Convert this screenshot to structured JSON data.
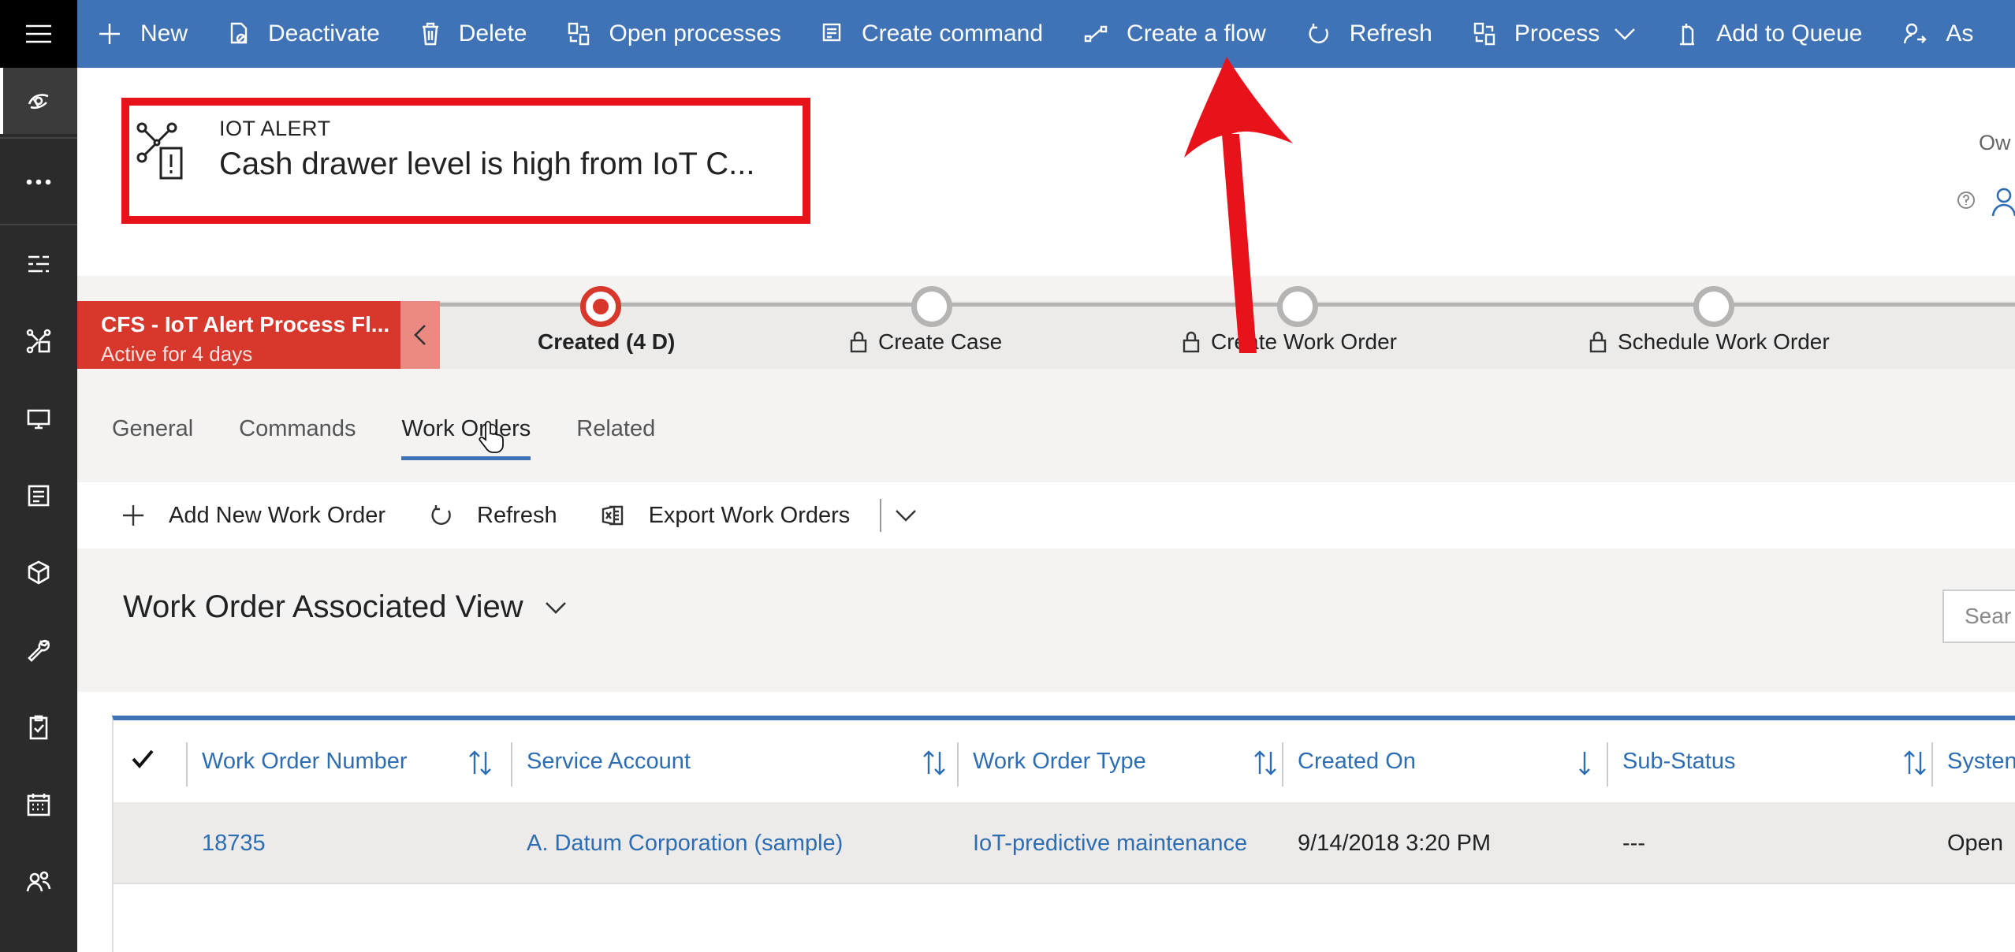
{
  "command_bar": {
    "items": [
      {
        "label": "New",
        "icon": "plus-icon"
      },
      {
        "label": "Deactivate",
        "icon": "deactivate-icon"
      },
      {
        "label": "Delete",
        "icon": "trash-icon"
      },
      {
        "label": "Open processes",
        "icon": "processes-icon"
      },
      {
        "label": "Create command",
        "icon": "command-icon"
      },
      {
        "label": "Create a flow",
        "icon": "flow-icon"
      },
      {
        "label": "Refresh",
        "icon": "refresh-icon"
      },
      {
        "label": "Process",
        "icon": "process-icon"
      },
      {
        "label": "Add to Queue",
        "icon": "queue-icon"
      },
      {
        "label": "As",
        "icon": "assign-icon"
      }
    ]
  },
  "header": {
    "entity_type": "IOT ALERT",
    "title": "Cash drawer level is high from IoT C...",
    "owner_label": "Ow"
  },
  "process_flow": {
    "name": "CFS - IoT Alert Process Fl...",
    "status": "Active for 4 days",
    "stages": [
      {
        "label": "Created  (4 D)",
        "active": true,
        "locked": false
      },
      {
        "label": "Create Case",
        "active": false,
        "locked": true
      },
      {
        "label": "Create Work Order",
        "active": false,
        "locked": true
      },
      {
        "label": "Schedule Work Order",
        "active": false,
        "locked": true
      }
    ]
  },
  "tabs": [
    {
      "label": "General",
      "selected": false
    },
    {
      "label": "Commands",
      "selected": false
    },
    {
      "label": "Work Orders",
      "selected": true
    },
    {
      "label": "Related",
      "selected": false
    }
  ],
  "subgrid": {
    "commands": [
      {
        "label": "Add New Work Order",
        "icon": "plus-icon"
      },
      {
        "label": "Refresh",
        "icon": "refresh-icon"
      },
      {
        "label": "Export Work Orders",
        "icon": "excel-icon"
      }
    ],
    "view_title": "Work Order Associated View",
    "search_placeholder": "Sear",
    "columns": [
      {
        "label": "Work Order Number",
        "sort": "both"
      },
      {
        "label": "Service Account",
        "sort": "both"
      },
      {
        "label": "Work Order Type",
        "sort": "both"
      },
      {
        "label": "Created On",
        "sort": "down"
      },
      {
        "label": "Sub-Status",
        "sort": "both"
      },
      {
        "label": "Systen",
        "sort": "none"
      }
    ],
    "rows": [
      {
        "work_order_number": "18735",
        "service_account": "A. Datum Corporation (sample)",
        "work_order_type": "IoT-predictive maintenance",
        "created_on": "9/14/2018 3:20 PM",
        "sub_status": "---",
        "system_status": "Open"
      }
    ]
  },
  "colors": {
    "command_bar": "#3f73b5",
    "nav_background": "#2b2b2b",
    "process_active": "#d8382b",
    "link": "#2d6db3",
    "annotation": "#e8131a"
  }
}
